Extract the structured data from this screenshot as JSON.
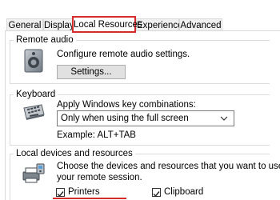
{
  "tabs": [
    {
      "label": "General"
    },
    {
      "label": "Display"
    },
    {
      "label": "Local Resources"
    },
    {
      "label": "Experience"
    },
    {
      "label": "Advanced"
    }
  ],
  "active_tab_index": 2,
  "remote_audio": {
    "legend": "Remote audio",
    "description": "Configure remote audio settings.",
    "settings_button": "Settings..."
  },
  "keyboard": {
    "legend": "Keyboard",
    "description": "Apply Windows key combinations:",
    "selected_option": "Only when using the full screen",
    "example": "Example: ALT+TAB"
  },
  "local_devices": {
    "legend": "Local devices and resources",
    "description_line1": "Choose the devices and resources that you want to use in",
    "description_line2": "your remote session.",
    "printers_label": "Printers",
    "printers_checked": true,
    "clipboard_label": "Clipboard",
    "clipboard_checked": true
  },
  "colors": {
    "highlight": "#d62b2b",
    "group_border": "#dcdcdc"
  },
  "icons": [
    "speaker-icon",
    "keyboard-icon",
    "devices-icon",
    "chevron-down-icon",
    "checkmark-icon"
  ]
}
